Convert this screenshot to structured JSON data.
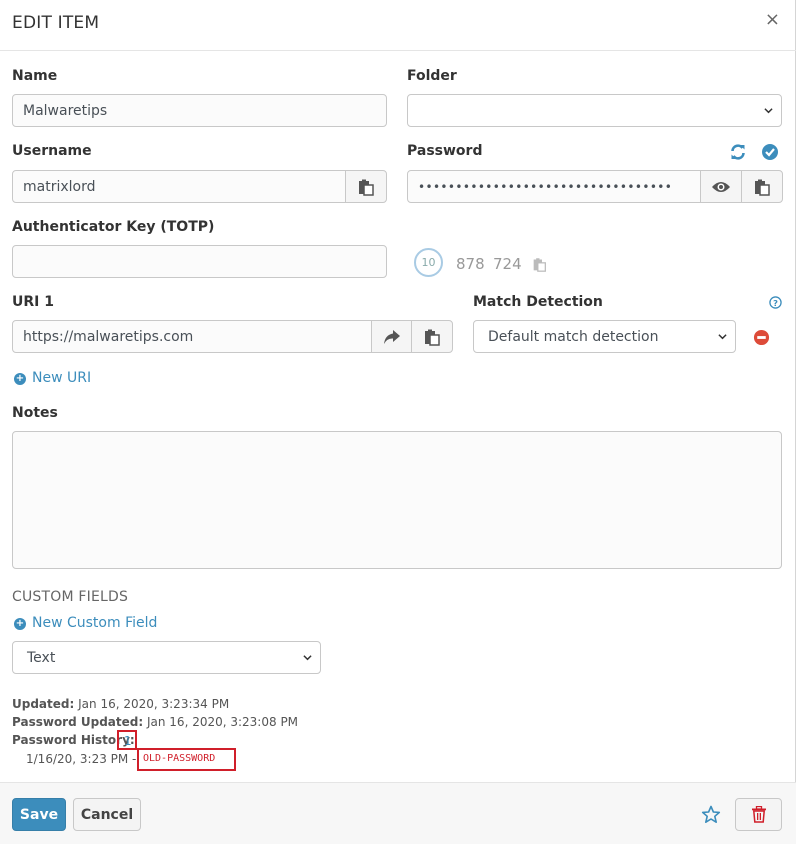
{
  "header": {
    "title": "EDIT ITEM",
    "close": "×"
  },
  "fields": {
    "name_label": "Name",
    "name_value": "Malwaretips",
    "folder_label": "Folder",
    "folder_value": "",
    "username_label": "Username",
    "username_value": "matrixlord",
    "password_label": "Password",
    "password_value": "••••••••••••••••••••••••••••••••••",
    "totp_label": "Authenticator Key (TOTP)",
    "totp_value": "",
    "totp_timer": "10",
    "totp_code_1": "878",
    "totp_code_2": "724"
  },
  "uri": {
    "label": "URI 1",
    "value": "https://malwaretips.com",
    "match_label": "Match Detection",
    "match_value": "Default match detection",
    "new_uri": "New URI"
  },
  "notes": {
    "label": "Notes",
    "value": ""
  },
  "custom_fields": {
    "title": "CUSTOM FIELDS",
    "new_field": "New Custom Field",
    "type_value": "Text"
  },
  "meta": {
    "updated_label": "Updated:",
    "updated_value": "Jan 16, 2020, 3:23:34 PM",
    "pw_updated_label": "Password Updated:",
    "pw_updated_value": "Jan 16, 2020, 3:23:08 PM",
    "history_label": "Password History:",
    "history_count": "1",
    "history_entry_date": "1/16/20, 3:23 PM -",
    "history_entry_value": "OLD-PASSWORD"
  },
  "footer": {
    "save": "Save",
    "cancel": "Cancel"
  },
  "colors": {
    "accent": "#3c8dbc",
    "save_bg": "#3c8dbc",
    "danger": "#d01f2a",
    "remove": "#dd4b39"
  }
}
